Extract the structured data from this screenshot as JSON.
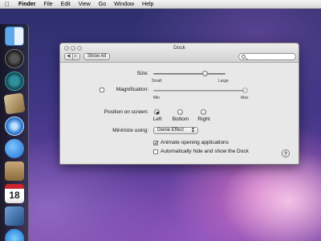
{
  "menubar": {
    "apple_icon": "apple-icon",
    "items": [
      "Finder",
      "File",
      "Edit",
      "View",
      "Go",
      "Window",
      "Help"
    ]
  },
  "dock_app": {
    "icons": [
      "finder-icon",
      "dashboard-icon",
      "time-machine-icon",
      "mail-icon",
      "safari-icon",
      "ichat-icon",
      "address-book-icon",
      "ical-icon",
      "preview-icon",
      "itunes-icon"
    ],
    "ical_date": "18"
  },
  "window": {
    "title": "Dock",
    "toolbar": {
      "back": "◀",
      "forward": "▶",
      "show_all": "Show All",
      "search_placeholder": ""
    }
  },
  "prefs": {
    "size": {
      "label": "Size:",
      "min_label": "Small",
      "max_label": "Large",
      "value_fraction": 0.72
    },
    "magnification": {
      "label": "Magnification:",
      "checked": false,
      "min_label": "Min",
      "max_label": "Max",
      "value_fraction": 1.0
    },
    "position": {
      "label": "Position on screen:",
      "options": [
        "Left",
        "Bottom",
        "Right"
      ],
      "selected": "Left"
    },
    "minimize": {
      "label": "Minimize using:",
      "value": "Genie Effect"
    },
    "animate": {
      "label": "Animate opening applications",
      "checked": true
    },
    "autohide": {
      "label": "Automatically hide and show the Dock",
      "checked": false
    },
    "help": "?"
  }
}
